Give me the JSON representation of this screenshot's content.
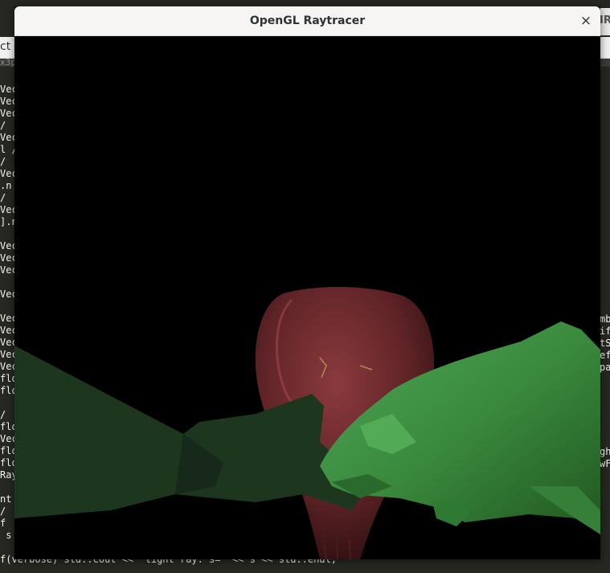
{
  "window": {
    "title": "OpenGL Raytracer",
    "close_glyph": "×"
  },
  "background_editor": {
    "toolbar_text": "ct",
    "strip_text": "x3p",
    "right_tab_text": "IR",
    "left_fragments": [
      "Vec",
      "Vec",
      "Vec",
      "/",
      "Vec",
      "l /",
      "/",
      "Vec",
      ".n",
      "/",
      "Vec",
      "].n",
      "Vec",
      "Vec",
      "Vec",
      "Vec",
      "Vec",
      "Vec",
      "Vec",
      "Vec",
      "Vec",
      "flo",
      "flo",
      "/",
      "flo",
      "Vec",
      "flo",
      "flo",
      "Ray",
      "nt",
      "/",
      "f",
      " s"
    ],
    "right_fragments": [
      "mb",
      "if",
      "tS",
      "ef",
      "pa",
      "gh",
      "wF"
    ],
    "bottom_line": "f(verbose) std::cout << \"light ray: s=\" << s << std::endl;"
  },
  "scene": {
    "description_colors": {
      "background": "#000000",
      "vase": "#6b2a2e",
      "dolphin_near": "#3b8a3f",
      "dolphin_far": "#1f3a20"
    }
  }
}
